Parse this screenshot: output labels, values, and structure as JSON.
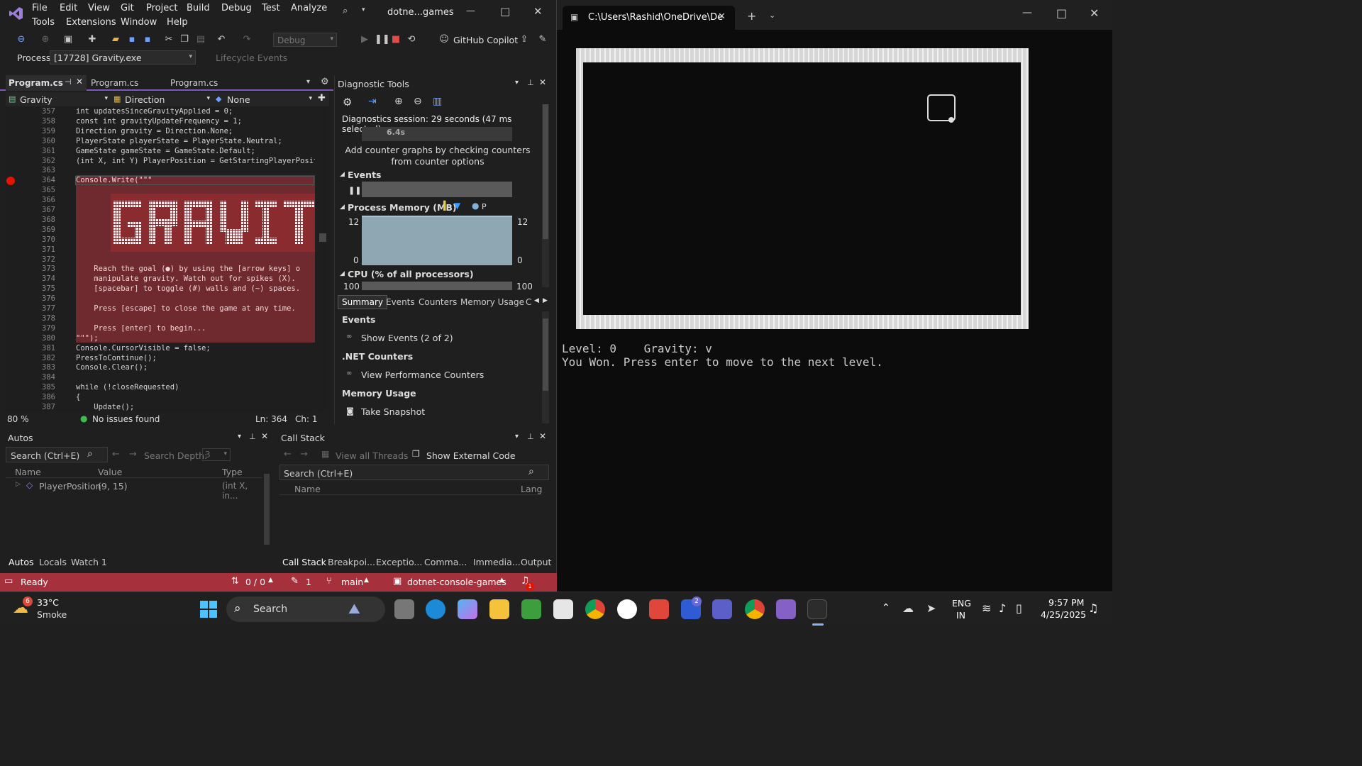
{
  "vs": {
    "menu": [
      "File",
      "Edit",
      "View",
      "Git",
      "Project",
      "Build",
      "Debug",
      "Test",
      "Analyze",
      "Tools",
      "Extensions",
      "Window",
      "Help"
    ],
    "solution_title": "dotne...games",
    "toolbar": {
      "config": "Debug",
      "copilot": "GitHub Copilot"
    },
    "process": {
      "label": "Process:",
      "value": "[17728] Gravity.exe",
      "lifecycle": "Lifecycle Events"
    },
    "editor_tabs": [
      "Program.cs",
      "Program.cs",
      "Program.cs"
    ],
    "nav": {
      "type": "Gravity",
      "member": "Direction",
      "third": "None"
    },
    "code_lines": [
      {
        "n": "357",
        "t": "int updatesSinceGravityApplied = 0;"
      },
      {
        "n": "358",
        "t": "const int gravityUpdateFrequency = 1;"
      },
      {
        "n": "359",
        "t": "Direction gravity = Direction.None;"
      },
      {
        "n": "360",
        "t": "PlayerState playerState = PlayerState.Neutral;"
      },
      {
        "n": "361",
        "t": "GameState gameState = GameState.Default;"
      },
      {
        "n": "362",
        "t": "(int X, int Y) PlayerPosition = GetStartingPlayerPosit"
      },
      {
        "n": "363",
        "t": ""
      },
      {
        "n": "364",
        "t": "Console.Write(\"\"\""
      },
      {
        "n": "365",
        "t": ""
      },
      {
        "n": "366",
        "t": ""
      },
      {
        "n": "367",
        "t": ""
      },
      {
        "n": "368",
        "t": ""
      },
      {
        "n": "369",
        "t": ""
      },
      {
        "n": "370",
        "t": ""
      },
      {
        "n": "371",
        "t": ""
      },
      {
        "n": "372",
        "t": ""
      },
      {
        "n": "373",
        "t": "    Reach the goal (●) by using the [arrow keys] o"
      },
      {
        "n": "374",
        "t": "    manipulate gravity. Watch out for spikes (X). "
      },
      {
        "n": "375",
        "t": "    [spacebar] to toggle (#) walls and (~) spaces."
      },
      {
        "n": "376",
        "t": ""
      },
      {
        "n": "377",
        "t": "    Press [escape] to close the game at any time."
      },
      {
        "n": "378",
        "t": ""
      },
      {
        "n": "379",
        "t": "    Press [enter] to begin..."
      },
      {
        "n": "380",
        "t": "\"\"\");"
      },
      {
        "n": "381",
        "t": "Console.CursorVisible = false;"
      },
      {
        "n": "382",
        "t": "PressToContinue();"
      },
      {
        "n": "383",
        "t": "Console.Clear();"
      },
      {
        "n": "384",
        "t": ""
      },
      {
        "n": "385",
        "t": "while (!closeRequested)"
      },
      {
        "n": "386",
        "t": "{"
      },
      {
        "n": "387",
        "t": "    Update();"
      }
    ],
    "ascii_art": "GRAVIT",
    "editor_status": {
      "zoom": "80 %",
      "issues": "No issues found",
      "ln": "Ln: 364",
      "ch": "Ch: 1"
    },
    "diag": {
      "title": "Diagnostic Tools",
      "session": "Diagnostics session: 29 seconds (47 ms selected)",
      "time_marker": "6.4s",
      "hint": "Add counter graphs by checking counters from counter options",
      "events_label": "Events",
      "memory_label": "Process Memory (MB)",
      "memory_legend": "P",
      "mem_max": "12",
      "mem_min": "0",
      "cpu_label": "CPU (% of all processors)",
      "cpu_max": "100",
      "tabs": [
        "Summary",
        "Events",
        "Counters",
        "Memory Usage",
        "C"
      ],
      "sections": [
        {
          "header": "Events",
          "item": "Show Events (2 of 2)"
        },
        {
          "header": ".NET Counters",
          "item": "View Performance Counters"
        },
        {
          "header": "Memory Usage",
          "item": "Take Snapshot"
        }
      ]
    },
    "autos": {
      "title": "Autos",
      "search": "Search (Ctrl+E)",
      "depth_label": "Search Depth:",
      "depth_value": "3",
      "cols": [
        "Name",
        "Value",
        "Type"
      ],
      "row": {
        "name": "PlayerPosition",
        "value": "(9, 15)",
        "type": "(int X, in..."
      },
      "tabs": [
        "Autos",
        "Locals",
        "Watch 1"
      ]
    },
    "callstack": {
      "title": "Call Stack",
      "view_threads": "View all Threads",
      "show_external": "Show External Code",
      "search": "Search (Ctrl+E)",
      "cols": [
        "Name",
        "Lang"
      ],
      "tabs": [
        "Call Stack",
        "Breakpoi...",
        "Exceptio...",
        "Comma...",
        "Immedia...",
        "Output"
      ]
    },
    "statusbar": {
      "ready": "Ready",
      "changes": "0 / 0",
      "edits": "1",
      "branch": "main",
      "repo": "dotnet-console-games",
      "notif": "1"
    }
  },
  "terminal": {
    "tab_title": "C:\\Users\\Rashid\\OneDrive\\De",
    "line1": "Level: 0    Gravity: v",
    "line2": "You Won. Press enter to move to the next level."
  },
  "taskbar": {
    "weather": {
      "temp": "33°C",
      "desc": "Smoke",
      "badge": "6"
    },
    "search": "Search",
    "lang": "ENG",
    "region": "IN",
    "time": "9:57 PM",
    "date": "4/25/2025",
    "teams_badge": "2"
  },
  "colors": {
    "accent": "#9a3030",
    "status_bar": "#a7303d",
    "breakpoint": "#e51400",
    "taskbar": "#202020"
  }
}
